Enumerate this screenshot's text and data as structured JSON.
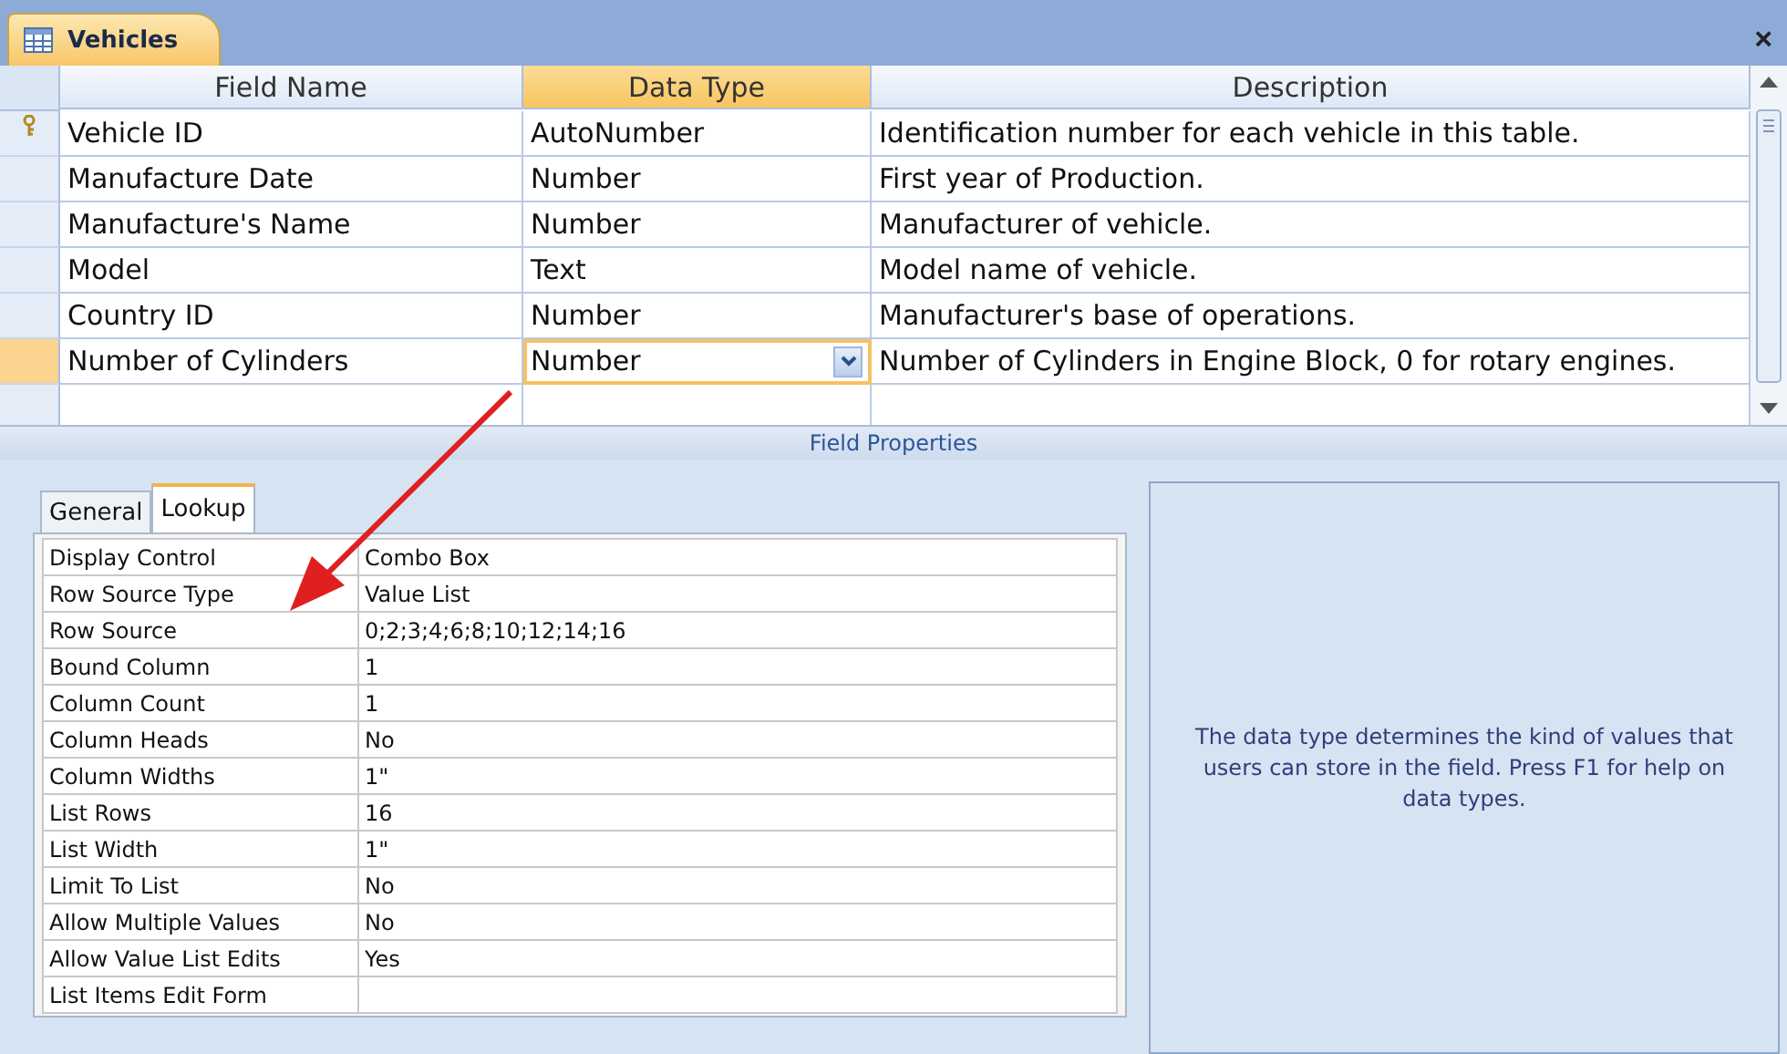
{
  "document_tab": {
    "title": "Vehicles",
    "close": "×"
  },
  "design_grid": {
    "columns": [
      {
        "label": "Field Name",
        "selected": false
      },
      {
        "label": "Data Type",
        "selected": true
      },
      {
        "label": "Description",
        "selected": false
      }
    ],
    "rows": [
      {
        "field_name": "Vehicle ID",
        "data_type": "AutoNumber",
        "description": "Identification number for each vehicle in this table.",
        "primary_key": true,
        "selected": false
      },
      {
        "field_name": "Manufacture Date",
        "data_type": "Number",
        "description": "First year of Production.",
        "primary_key": false,
        "selected": false
      },
      {
        "field_name": "Manufacture's Name",
        "data_type": "Number",
        "description": "Manufacturer of vehicle.",
        "primary_key": false,
        "selected": false
      },
      {
        "field_name": "Model",
        "data_type": "Text",
        "description": "Model name of vehicle.",
        "primary_key": false,
        "selected": false
      },
      {
        "field_name": "Country ID",
        "data_type": "Number",
        "description": "Manufacturer's base of operations.",
        "primary_key": false,
        "selected": false
      },
      {
        "field_name": "Number of Cylinders",
        "data_type": "Number",
        "description": "Number of Cylinders in Engine Block, 0 for rotary engines.",
        "primary_key": false,
        "selected": true
      }
    ]
  },
  "field_properties": {
    "title": "Field Properties",
    "tabs": [
      {
        "label": "General",
        "selected": false
      },
      {
        "label": "Lookup",
        "selected": true
      }
    ],
    "properties": [
      {
        "name": "Display Control",
        "value": "Combo Box"
      },
      {
        "name": "Row Source Type",
        "value": "Value List"
      },
      {
        "name": "Row Source",
        "value": "0;2;3;4;6;8;10;12;14;16"
      },
      {
        "name": "Bound Column",
        "value": "1"
      },
      {
        "name": "Column Count",
        "value": "1"
      },
      {
        "name": "Column Heads",
        "value": "No"
      },
      {
        "name": "Column Widths",
        "value": "1\""
      },
      {
        "name": "List Rows",
        "value": "16"
      },
      {
        "name": "List Width",
        "value": "1\""
      },
      {
        "name": "Limit To List",
        "value": "No"
      },
      {
        "name": "Allow Multiple Values",
        "value": "No"
      },
      {
        "name": "Allow Value List Edits",
        "value": "Yes"
      },
      {
        "name": "List Items Edit Form"
      }
    ],
    "help_text": "The data type determines the kind of values that users can store in the field.  Press F1 for help on data types."
  }
}
